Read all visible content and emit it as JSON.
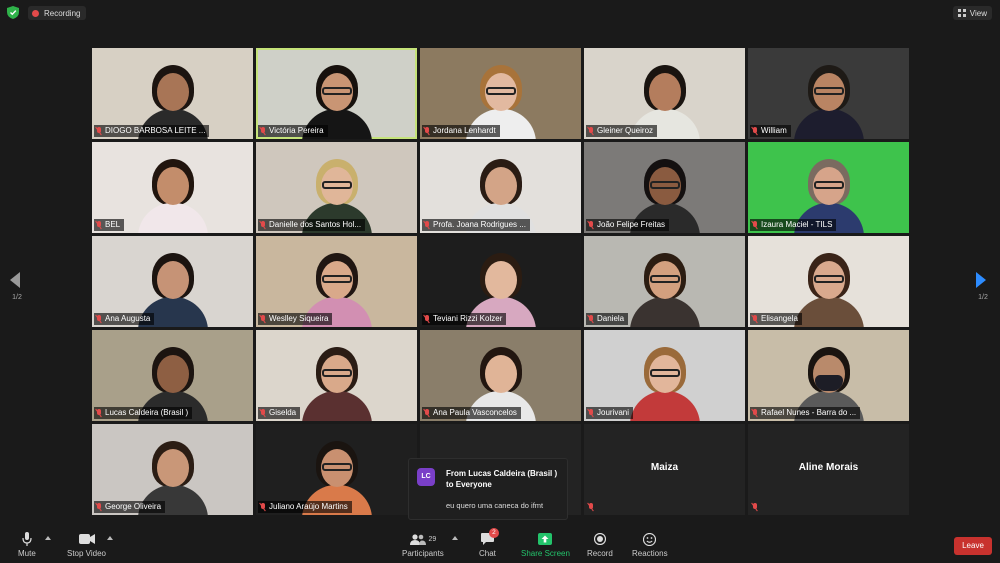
{
  "topbar": {
    "recording_label": "Recording",
    "view_label": "View"
  },
  "navigation": {
    "page_left": "1/2",
    "page_right": "1/2"
  },
  "participants": [
    {
      "name": "DIOGO BARBOSA LEITE ...",
      "bg": "#d7d0c4",
      "skin": "#a87556",
      "hair": "#1c1410",
      "shirt": "#2a2a2a",
      "glasses": false,
      "active": false
    },
    {
      "name": "Victória Pereira",
      "bg": "#cfd0c8",
      "skin": "#c99574",
      "hair": "#17110d",
      "shirt": "#151515",
      "glasses": true,
      "active": true
    },
    {
      "name": "Jordana Lenhardt",
      "bg": "#8c7a60",
      "skin": "#e2b9a0",
      "hair": "#a8733a",
      "shirt": "#eeeeee",
      "glasses": true,
      "active": false
    },
    {
      "name": "Gleiner Queiroz",
      "bg": "#d9d4cb",
      "skin": "#b47d5d",
      "hair": "#1a1410",
      "shirt": "#e6e6e0",
      "glasses": false,
      "active": false
    },
    {
      "name": "William",
      "bg": "#3a3a3a",
      "skin": "#b98463",
      "hair": "#1e1a16",
      "shirt": "#1d1d2e",
      "glasses": true,
      "active": false
    },
    {
      "name": "BEL",
      "bg": "#e8e3df",
      "skin": "#c38d6b",
      "hair": "#21150e",
      "shirt": "#f1e7ea",
      "glasses": false,
      "active": false
    },
    {
      "name": "Danielle dos Santos Hol...",
      "bg": "#cfc7bd",
      "skin": "#e0b699",
      "hair": "#c9b06d",
      "shirt": "#2c3a2c",
      "glasses": true,
      "active": false
    },
    {
      "name": "Profa. Joana Rodrigues ...",
      "bg": "#e3e0dc",
      "skin": "#d3a487",
      "hair": "#2a1c14",
      "shirt": "#e0e0e0",
      "glasses": false,
      "active": false
    },
    {
      "name": "João Felipe Freitas",
      "bg": "#7c7a78",
      "skin": "#8a5b40",
      "hair": "#141010",
      "shirt": "#2a2a2a",
      "glasses": true,
      "active": false
    },
    {
      "name": "Izaura Maciel - TILS",
      "bg": "#3ec34c",
      "skin": "#d6a48a",
      "hair": "#7a6b60",
      "shirt": "#2c3b6e",
      "glasses": true,
      "active": false
    },
    {
      "name": "Ana Augusta",
      "bg": "#d9d5d0",
      "skin": "#c69376",
      "hair": "#1c1410",
      "shirt": "#27364d",
      "glasses": false,
      "active": false
    },
    {
      "name": "Weslley Siqueira",
      "bg": "#c9b79e",
      "skin": "#d9a98a",
      "hair": "#201612",
      "shirt": "#d28fb2",
      "glasses": true,
      "active": false
    },
    {
      "name": "Teviani Rizzi Kolzer",
      "bg": "#1d1d1d",
      "skin": "#e2b89d",
      "hair": "#2b1c12",
      "shirt": "#d7a8c0",
      "glasses": false,
      "active": false
    },
    {
      "name": "Daniela",
      "bg": "#b9b8b2",
      "skin": "#d3a07f",
      "hair": "#2c1d12",
      "shirt": "#3a3330",
      "glasses": true,
      "active": false
    },
    {
      "name": "Elisangela",
      "bg": "#e6e1da",
      "skin": "#d9a98d",
      "hair": "#3a2418",
      "shirt": "#6a4e3a",
      "glasses": true,
      "active": false
    },
    {
      "name": "Lucas Caldeira  (Brasil )",
      "bg": "#a9a08a",
      "skin": "#8e5f43",
      "hair": "#1c1410",
      "shirt": "#2b2b2b",
      "glasses": false,
      "active": false
    },
    {
      "name": "Giselda",
      "bg": "#dcd6cc",
      "skin": "#d9a98a",
      "hair": "#2a1c14",
      "shirt": "#5a3030",
      "glasses": true,
      "active": false
    },
    {
      "name": "Ana Paula Vasconcelos",
      "bg": "#8a7e6a",
      "skin": "#e0b497",
      "hair": "#221610",
      "shirt": "#e8e8e8",
      "glasses": false,
      "active": false
    },
    {
      "name": "Jourivani",
      "bg": "#d0d0d0",
      "skin": "#e2b69b",
      "hair": "#9a6a3a",
      "shirt": "#c23a3a",
      "glasses": true,
      "active": false
    },
    {
      "name": "Rafael Nunes - Barra do ...",
      "bg": "#c8bda8",
      "skin": "#b98a6b",
      "hair": "#1a1410",
      "shirt": "#5a5a5a",
      "glasses": false,
      "active": false,
      "mask": true
    },
    {
      "name": "George Oliveira",
      "bg": "#cac6c2",
      "skin": "#c99778",
      "hair": "#2b1d14",
      "shirt": "#383838",
      "glasses": false,
      "active": false
    },
    {
      "name": "Juliano Araújo Martins",
      "bg": "#1f1f1f",
      "skin": "#c99070",
      "hair": "#1a1410",
      "shirt": "#d97a4a",
      "glasses": true,
      "active": false
    },
    {
      "name": "",
      "bg": "#232323",
      "empty": true
    },
    {
      "name": "Maiza",
      "bg": "#232323",
      "empty": true,
      "center_name": true
    },
    {
      "name": "Aline Morais",
      "bg": "#232323",
      "empty": true,
      "center_name": true
    }
  ],
  "chat_popup": {
    "avatar_initials": "LC",
    "from_line": "From Lucas Caldeira  (Brasil )",
    "to_line": "to Everyone",
    "message": "eu quero uma caneca do ifmt"
  },
  "toolbar": {
    "mute_label": "Mute",
    "stop_video_label": "Stop Video",
    "participants_label": "Participants",
    "participants_count": "29",
    "chat_label": "Chat",
    "chat_badge": "2",
    "share_screen_label": "Share Screen",
    "record_label": "Record",
    "reactions_label": "Reactions",
    "leave_label": "Leave"
  },
  "colors": {
    "background": "#1a1a1a",
    "active_speaker": "#c5e37a",
    "leave": "#c8322e",
    "share": "#23c36b",
    "muted": "#e24a4a"
  }
}
